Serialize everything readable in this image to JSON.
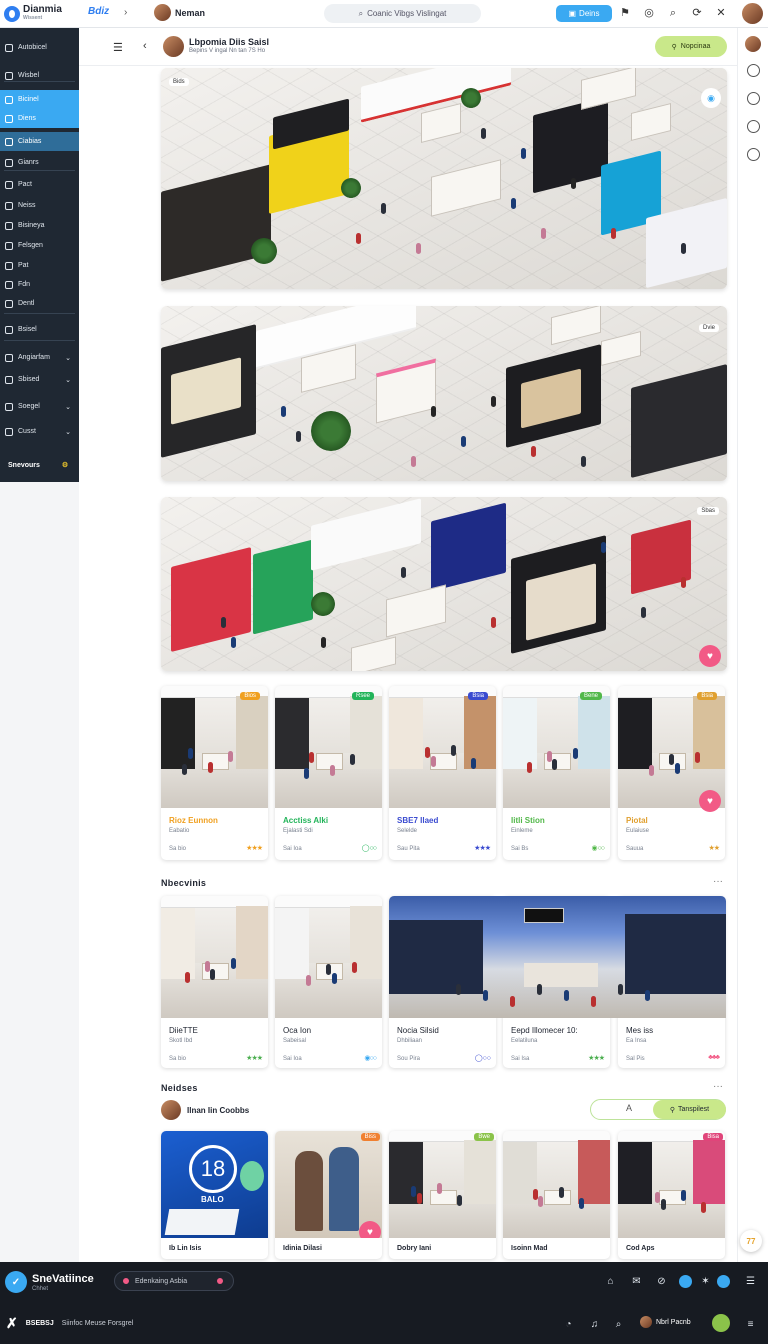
{
  "app": {
    "logo_text": "Dianmia",
    "logo_sub": "Wissent",
    "brand": "Bdiz",
    "user_name": "Neman"
  },
  "search": {
    "placeholder": "Coanic Vibgs Vislingat"
  },
  "toolbar": {
    "primary_button": "Deins"
  },
  "sidebar": {
    "items": [
      {
        "label": "Autobicel",
        "state": "normal"
      },
      {
        "label": "Wisbel",
        "state": "normal"
      },
      {
        "label": "Bicinel",
        "state": "active"
      },
      {
        "label": "Diens",
        "state": "active"
      },
      {
        "label": "Ciabias",
        "state": "light"
      },
      {
        "label": "Gianrs",
        "state": "normal"
      },
      {
        "label": "Pact",
        "state": "normal"
      },
      {
        "label": "Neiss",
        "state": "normal"
      },
      {
        "label": "Bisineya",
        "state": "normal"
      },
      {
        "label": "Felsgen",
        "state": "normal"
      },
      {
        "label": "Pat",
        "state": "normal"
      },
      {
        "label": "Fdn",
        "state": "normal"
      },
      {
        "label": "Dentl",
        "state": "normal"
      },
      {
        "label": "Bsisel",
        "state": "normal"
      },
      {
        "label": "Angiarfam",
        "state": "caret"
      },
      {
        "label": "Sbised",
        "state": "caret"
      },
      {
        "label": "Soegel",
        "state": "caret"
      },
      {
        "label": "Cusst",
        "state": "caret"
      }
    ],
    "footer": "Snevours"
  },
  "subheader": {
    "title": "Lbpomia Diis Saisl",
    "subtitle": "Bepins V ingal Nn tan 7S Ho",
    "action": "Nopcinaa"
  },
  "heroes": [
    {
      "badge": "Bids"
    },
    {
      "badge": "Dvie"
    },
    {
      "badge": "Sbas"
    }
  ],
  "cards_row1": [
    {
      "title": "Rioz Eunnon",
      "sub": "Eabatio",
      "meta": "Sa bio",
      "stars": "★★★",
      "badge": "Bios",
      "accent": "#f0a020"
    },
    {
      "title": "Acctiss Alki",
      "sub": "Ejalasti Sdi",
      "meta": "Sai Ioa",
      "stars": "◯ ○○",
      "badge": "Rsee",
      "accent": "#23b45a"
    },
    {
      "title": "SBE7 Ilaed",
      "sub": "Selelde",
      "meta": "Sau Pita",
      "stars": "★★★",
      "badge": "Bsia",
      "accent": "#3a4bd0"
    },
    {
      "title": "Iitli Stion",
      "sub": "Einleme",
      "meta": "Sai Bs",
      "stars": "◉ ○○",
      "badge": "Bene",
      "accent": "#52b84a"
    },
    {
      "title": "Piotal",
      "sub": "Eulaiuse",
      "meta": "Sauua",
      "stars": "★★",
      "badge": "Bsia",
      "accent": "#e0a030"
    }
  ],
  "section1": {
    "title": "Nbecvinis",
    "more": "···"
  },
  "cards_row2": [
    {
      "title": "DiieTTE",
      "sub": "Skotl Ibd",
      "meta": "Sa bio",
      "stars": "★★★"
    },
    {
      "title": "Oca Ion",
      "sub": "Sabeisal",
      "meta": "Sai Ioa",
      "stars": "◉○○"
    },
    {
      "title": "Nocia Silsid",
      "sub": "Dhbiliaan",
      "meta": "Sou Pira",
      "stars": "◯ ○ ○"
    },
    {
      "title": "Eepd Illomecer 10:",
      "sub": "Eelatiluna",
      "meta": "Sai Isa",
      "stars": "★★★"
    },
    {
      "title": "Mes iss",
      "sub": "Ea Insa",
      "meta": "Sal Pis",
      "stars": "♣♣♣"
    }
  ],
  "section2": {
    "title": "Neidses",
    "more": "···"
  },
  "row3": {
    "user": "Ilnan Iin Coobbs",
    "action": "Tanspilest",
    "outline_icon": "A"
  },
  "cards_row3": [
    {
      "title": "Ib Lin Isis",
      "badge_text": "18",
      "badge_sub": "BALO"
    },
    {
      "title": "Idinia Dilasi",
      "tag": "Biss"
    },
    {
      "title": "Dobry Iani",
      "tag": "Bwe"
    },
    {
      "title": "Isoinn Mad",
      "tag": ""
    },
    {
      "title": "Cod Aps",
      "tag": "Bisa"
    }
  ],
  "bottom": {
    "name": "SneVatiince",
    "sub": "Chhet",
    "pill": "Edenkaing Asbia",
    "row2_app": "BSEBSJ",
    "row2_text": "Siinfoc Meuse Forsgrel",
    "user": "Nbrl Pacnb"
  },
  "help": {
    "label": "77"
  }
}
